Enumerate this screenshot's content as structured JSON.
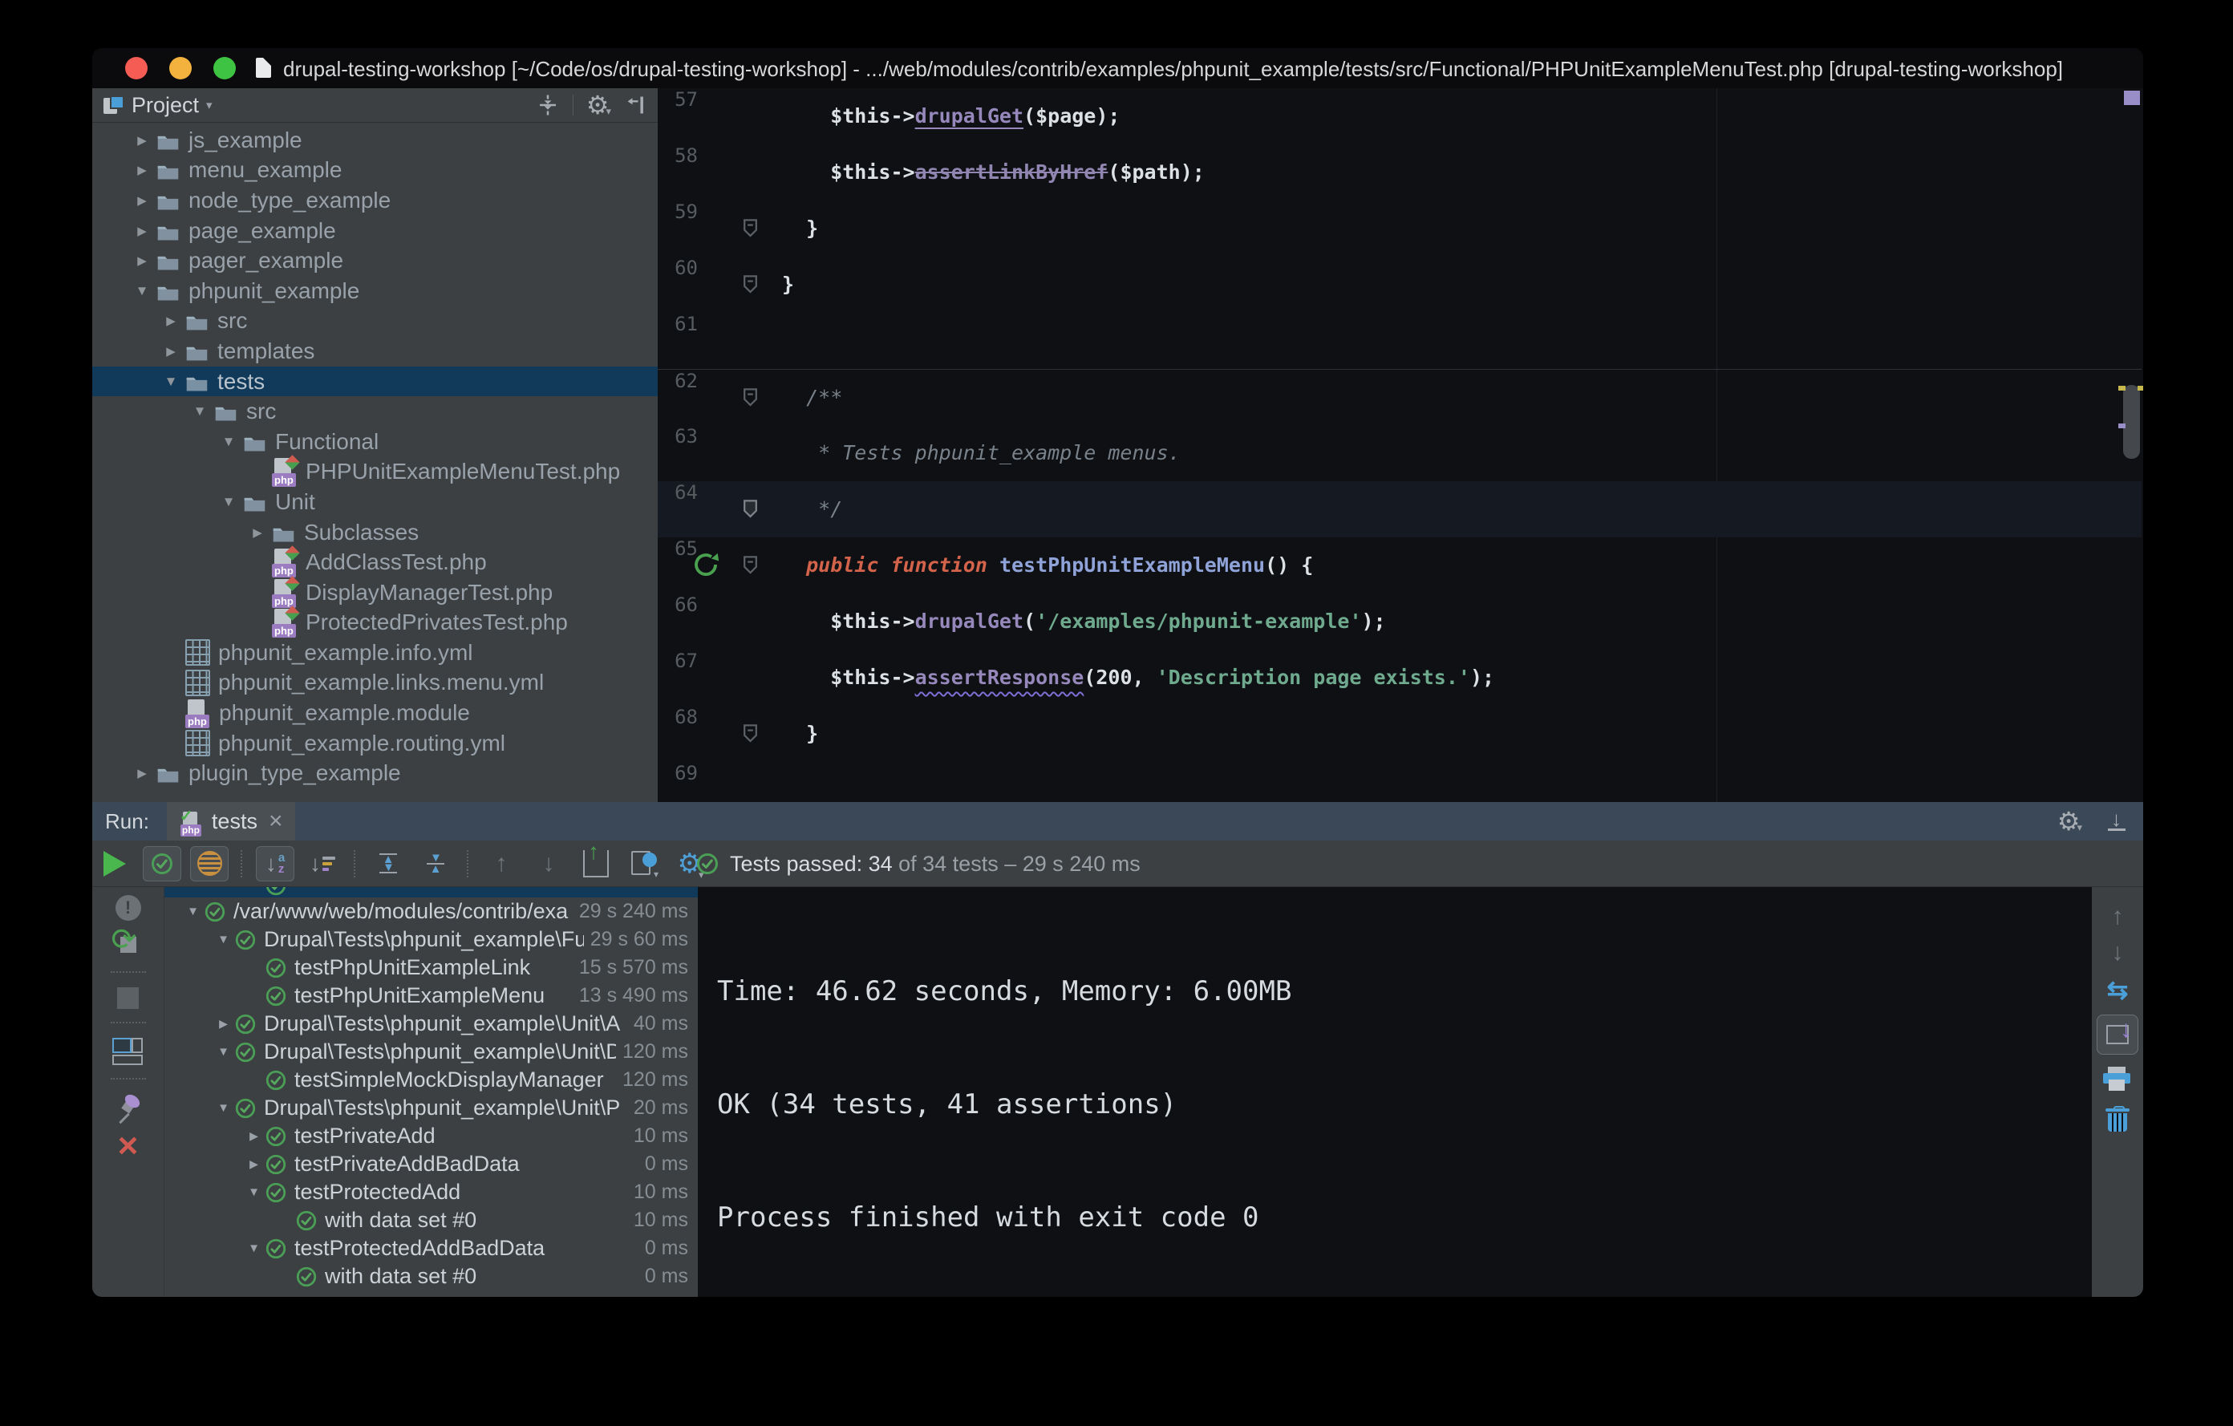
{
  "window": {
    "title": "drupal-testing-workshop [~/Code/os/drupal-testing-workshop] - .../web/modules/contrib/examples/phpunit_example/tests/src/Functional/PHPUnitExampleMenuTest.php [drupal-testing-workshop]"
  },
  "colors": {
    "selection_blue": "#113a5a",
    "pass_green": "#4a9e55",
    "php_badge_purple": "#9b7cc1",
    "keyword_orange": "#d3634a",
    "string_green": "#6faa8f",
    "method_purple": "#9688bb",
    "run_tabbar_blue": "#3b4857",
    "panel_grey": "#3c4043",
    "editor_bg": "#0e1013",
    "close_red": "#d05a52"
  },
  "project_panel": {
    "title": "Project",
    "header_icons": [
      "collapse-all-icon",
      "settings-gear-icon",
      "hide-panel-icon"
    ],
    "tree": [
      {
        "label": "js_example",
        "level": 0,
        "icon": "folder",
        "arrow": "collapsed"
      },
      {
        "label": "menu_example",
        "level": 0,
        "icon": "folder",
        "arrow": "collapsed"
      },
      {
        "label": "node_type_example",
        "level": 0,
        "icon": "folder",
        "arrow": "collapsed"
      },
      {
        "label": "page_example",
        "level": 0,
        "icon": "folder",
        "arrow": "collapsed"
      },
      {
        "label": "pager_example",
        "level": 0,
        "icon": "folder",
        "arrow": "collapsed"
      },
      {
        "label": "phpunit_example",
        "level": 0,
        "icon": "folder",
        "arrow": "expanded"
      },
      {
        "label": "src",
        "level": 1,
        "icon": "folder",
        "arrow": "collapsed"
      },
      {
        "label": "templates",
        "level": 1,
        "icon": "folder",
        "arrow": "collapsed"
      },
      {
        "label": "tests",
        "level": 1,
        "icon": "folder",
        "arrow": "expanded",
        "selected": true
      },
      {
        "label": "src",
        "level": 2,
        "icon": "folder",
        "arrow": "expanded"
      },
      {
        "label": "Functional",
        "level": 3,
        "icon": "folder",
        "arrow": "expanded"
      },
      {
        "label": "PHPUnitExampleMenuTest.php",
        "level": 4,
        "icon": "php-test"
      },
      {
        "label": "Unit",
        "level": 3,
        "icon": "folder",
        "arrow": "expanded"
      },
      {
        "label": "Subclasses",
        "level": 4,
        "icon": "folder",
        "arrow": "collapsed"
      },
      {
        "label": "AddClassTest.php",
        "level": 4,
        "icon": "php-test"
      },
      {
        "label": "DisplayManagerTest.php",
        "level": 4,
        "icon": "php-test"
      },
      {
        "label": "ProtectedPrivatesTest.php",
        "level": 4,
        "icon": "php-test"
      },
      {
        "label": "phpunit_example.info.yml",
        "level": 1,
        "icon": "yml"
      },
      {
        "label": "phpunit_example.links.menu.yml",
        "level": 1,
        "icon": "yml"
      },
      {
        "label": "phpunit_example.module",
        "level": 1,
        "icon": "php-module"
      },
      {
        "label": "phpunit_example.routing.yml",
        "level": 1,
        "icon": "yml"
      },
      {
        "label": "plugin_type_example",
        "level": 0,
        "icon": "folder",
        "arrow": "collapsed"
      }
    ]
  },
  "editor": {
    "current_line": "64",
    "lines": [
      {
        "num": "57",
        "gutter": [],
        "segs": [
          {
            "t": "    $this->",
            "s": "pl"
          },
          {
            "t": "drupalGet",
            "s": "mu"
          },
          {
            "t": "($page);",
            "s": "pl"
          }
        ]
      },
      {
        "num": "58",
        "gutter": [],
        "segs": [
          {
            "t": "    $this->",
            "s": "pl"
          },
          {
            "t": "assertLinkByHref",
            "s": "ms"
          },
          {
            "t": "($path);",
            "s": "pl"
          }
        ]
      },
      {
        "num": "59",
        "gutter": [
          "shield"
        ],
        "segs": [
          {
            "t": "  }",
            "s": "pl"
          }
        ]
      },
      {
        "num": "60",
        "gutter": [
          "shield"
        ],
        "segs": [
          {
            "t": "}",
            "s": "pl"
          }
        ]
      },
      {
        "num": "61",
        "gutter": [],
        "segs": []
      },
      {
        "num": "62",
        "gutter": [
          "shield"
        ],
        "separator": true,
        "segs": [
          {
            "t": "  /**",
            "s": "cm"
          }
        ]
      },
      {
        "num": "63",
        "gutter": [],
        "segs": [
          {
            "t": "   * Tests phpunit_example menus.",
            "s": "cm"
          }
        ]
      },
      {
        "num": "64",
        "gutter": [
          "shield-dark"
        ],
        "current": true,
        "segs": [
          {
            "t": "   */",
            "s": "cm"
          }
        ]
      },
      {
        "num": "65",
        "gutter": [
          "run",
          "shield"
        ],
        "segs": [
          {
            "t": "  ",
            "s": "pl"
          },
          {
            "t": "public function ",
            "s": "kw"
          },
          {
            "t": "testPhpUnitExampleMenu",
            "s": "fn"
          },
          {
            "t": "() {",
            "s": "pl"
          }
        ]
      },
      {
        "num": "66",
        "gutter": [],
        "segs": [
          {
            "t": "    $this->",
            "s": "pl"
          },
          {
            "t": "drupalGet",
            "s": "m"
          },
          {
            "t": "(",
            "s": "pl"
          },
          {
            "t": "'/examples/phpunit-example'",
            "s": "st"
          },
          {
            "t": ");",
            "s": "pl"
          }
        ]
      },
      {
        "num": "67",
        "gutter": [],
        "segs": [
          {
            "t": "    $this->",
            "s": "pl"
          },
          {
            "t": "assertResponse",
            "s": "mw"
          },
          {
            "t": "(200, ",
            "s": "pl"
          },
          {
            "t": "'Description page exists.'",
            "s": "st"
          },
          {
            "t": ");",
            "s": "pl"
          }
        ]
      },
      {
        "num": "68",
        "gutter": [
          "shield"
        ],
        "segs": [
          {
            "t": "  }",
            "s": "pl"
          }
        ]
      },
      {
        "num": "69",
        "gutter": [],
        "segs": []
      }
    ]
  },
  "run_panel": {
    "run_label": "Run:",
    "tab": {
      "label": "tests"
    },
    "toolbar_icons": [
      "rerun-button",
      "show-passed-toggle",
      "show-ignored-toggle",
      "sort-alphabetically-toggle",
      "sort-by-duration-button",
      "expand-all-button",
      "collapse-all-button",
      "previous-failed-button",
      "next-failed-button",
      "import-test-results-button",
      "test-history-button",
      "run-options-gear-button"
    ],
    "status": {
      "strong": "Tests passed: 34",
      "rest": " of 34 tests – 29 s 240 ms"
    },
    "left_icons": [
      "rerun-failed-balloon-button",
      "toggle-auto-test-button",
      "stop-button",
      "show-console-layout-button",
      "pin-tab-button",
      "close-panel-button"
    ],
    "right_icons": [
      "scroll-up-button",
      "scroll-down-button",
      "soft-wrap-button",
      "scroll-to-end-button",
      "print-button",
      "clear-all-button"
    ],
    "header_icons": [
      "run-settings-gear-button",
      "hide-panel-button"
    ],
    "test_tree": [
      {
        "label": "/var/www/web/modules/contrib/exa",
        "time": "29 s 240 ms",
        "level": 0,
        "arrow": "expanded"
      },
      {
        "label": "Drupal\\Tests\\phpunit_example\\Fu",
        "time": "29 s 60 ms",
        "level": 1,
        "arrow": "expanded"
      },
      {
        "label": "testPhpUnitExampleLink",
        "time": "15 s 570 ms",
        "level": 2
      },
      {
        "label": "testPhpUnitExampleMenu",
        "time": "13 s 490 ms",
        "level": 2
      },
      {
        "label": "Drupal\\Tests\\phpunit_example\\Unit\\A",
        "time": "40 ms",
        "level": 1,
        "arrow": "collapsed"
      },
      {
        "label": "Drupal\\Tests\\phpunit_example\\Unit\\D",
        "time": "120 ms",
        "level": 1,
        "arrow": "expanded"
      },
      {
        "label": "testSimpleMockDisplayManager",
        "time": "120 ms",
        "level": 2
      },
      {
        "label": "Drupal\\Tests\\phpunit_example\\Unit\\P",
        "time": "20 ms",
        "level": 1,
        "arrow": "expanded"
      },
      {
        "label": "testPrivateAdd",
        "time": "10 ms",
        "level": 2,
        "arrow": "collapsed"
      },
      {
        "label": "testPrivateAddBadData",
        "time": "0 ms",
        "level": 2,
        "arrow": "collapsed"
      },
      {
        "label": "testProtectedAdd",
        "time": "10 ms",
        "level": 2,
        "arrow": "expanded"
      },
      {
        "label": "with data set #0",
        "time": "10 ms",
        "level": 3
      },
      {
        "label": "testProtectedAddBadData",
        "time": "0 ms",
        "level": 2,
        "arrow": "expanded"
      },
      {
        "label": "with data set #0",
        "time": "0 ms",
        "level": 3
      }
    ],
    "console": [
      "Time: 46.62 seconds, Memory: 6.00MB",
      "OK (34 tests, 41 assertions)",
      "Process finished with exit code 0"
    ]
  }
}
